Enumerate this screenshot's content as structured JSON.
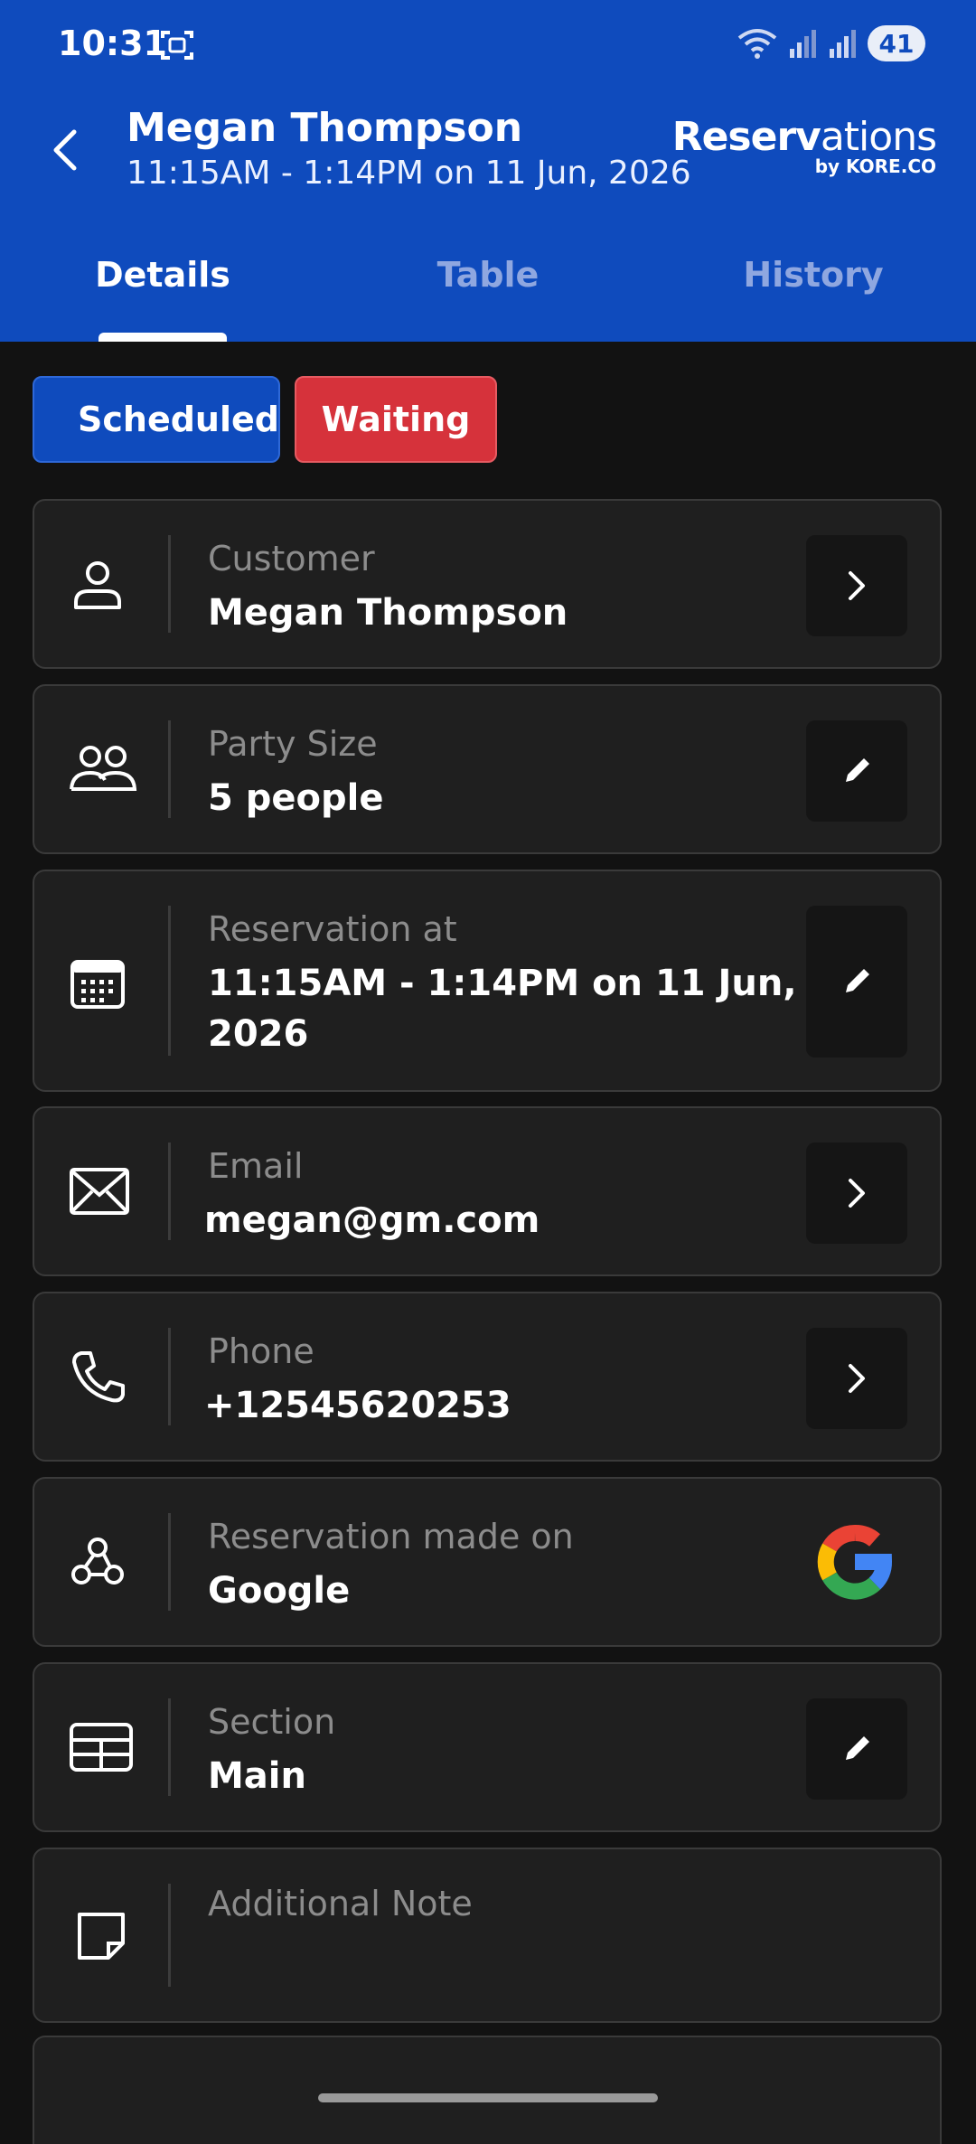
{
  "status_bar": {
    "time": "10:31",
    "battery": "41"
  },
  "header": {
    "title": "Megan Thompson",
    "subtitle": "11:15AM - 1:14PM on 11 Jun, 2026",
    "brand_main": "Reserv",
    "brand_thin": "ations",
    "brand_by": "by KORE.CO"
  },
  "tabs": [
    {
      "label": "Details",
      "active": true
    },
    {
      "label": "Table",
      "active": false
    },
    {
      "label": "History",
      "active": false
    }
  ],
  "chips": {
    "status": "Scheduled",
    "state": "Waiting"
  },
  "fields": {
    "customer": {
      "label": "Customer",
      "value": "Megan Thompson"
    },
    "party": {
      "label": "Party Size",
      "value": "5 people"
    },
    "reservation_at": {
      "label": "Reservation at",
      "value_line1": "11:15AM - 1:14PM on 11 Jun,",
      "value_line2": "2026"
    },
    "email": {
      "label": "Email",
      "value": "megan@gm.com"
    },
    "phone": {
      "label": "Phone",
      "value": "+12545620253"
    },
    "made_on": {
      "label": "Reservation made on",
      "value": "Google"
    },
    "section": {
      "label": "Section",
      "value": "Main"
    },
    "note": {
      "label": "Additional Note"
    }
  },
  "colors": {
    "brand_blue": "#0f4bbd",
    "waiting_red": "#d6323b",
    "card_bg": "#1f1f1f"
  }
}
